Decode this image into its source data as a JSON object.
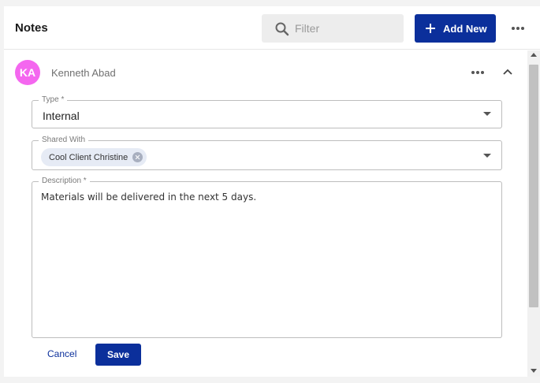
{
  "header": {
    "title": "Notes",
    "filter_placeholder": "Filter",
    "add_new_label": "Add New",
    "more_icon": "more-horizontal-icon"
  },
  "note": {
    "avatar_initials": "KA",
    "avatar_color": "#f467ef",
    "author": "Kenneth Abad",
    "type_label": "Type *",
    "type_value": "Internal",
    "shared_label": "Shared With",
    "shared_chips": [
      "Cool Client Christine"
    ],
    "description_label": "Description *",
    "description_value": "Materials will be delivered in the next 5 days.",
    "cancel_label": "Cancel",
    "save_label": "Save"
  },
  "colors": {
    "primary": "#0b2f9b",
    "avatar": "#f467ef"
  }
}
